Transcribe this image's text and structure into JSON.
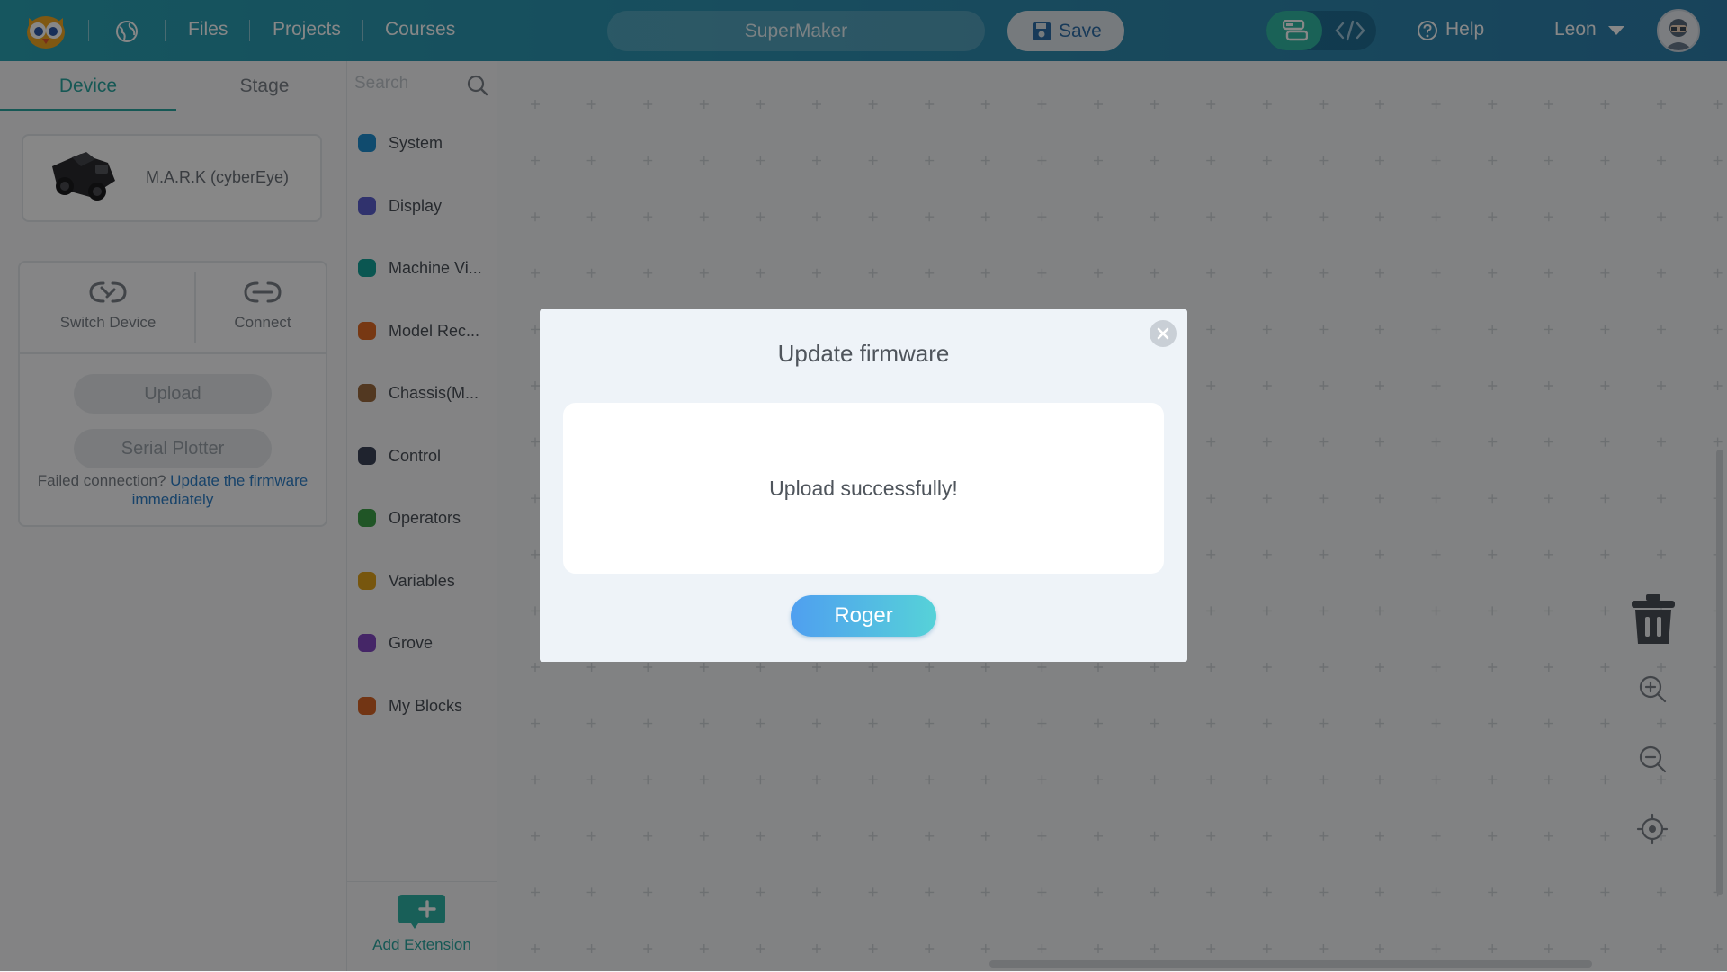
{
  "topbar": {
    "nav": [
      "Files",
      "Projects",
      "Courses"
    ],
    "project_name": "SuperMaker",
    "save_label": "Save",
    "help_label": "Help",
    "user_name": "Leon"
  },
  "left_panel": {
    "tabs": [
      "Device",
      "Stage"
    ],
    "device_name": "M.A.R.K (cyberEye)",
    "switch_device_label": "Switch Device",
    "connect_label": "Connect",
    "upload_label": "Upload",
    "serial_plotter_label": "Serial Plotter",
    "failed_text": "Failed connection? ",
    "failed_link": "Update the firmware immediately"
  },
  "categories": {
    "search_placeholder": "Search",
    "items": [
      {
        "label": "System",
        "color": "#1f8fd0"
      },
      {
        "label": "Display",
        "color": "#5c5fcf"
      },
      {
        "label": "Machine Vi...",
        "color": "#13a39a"
      },
      {
        "label": "Model Rec...",
        "color": "#e06a25"
      },
      {
        "label": "Chassis(M...",
        "color": "#9c6b3f"
      },
      {
        "label": "Control",
        "color": "#3c4258"
      },
      {
        "label": "Operators",
        "color": "#3da149"
      },
      {
        "label": "Variables",
        "color": "#e0a21c"
      },
      {
        "label": "Grove",
        "color": "#8349c2"
      },
      {
        "label": "My Blocks",
        "color": "#d86526"
      }
    ],
    "add_extension_label": "Add Extension"
  },
  "modal": {
    "title": "Update firmware",
    "message": "Upload successfully!",
    "button_label": "Roger"
  }
}
